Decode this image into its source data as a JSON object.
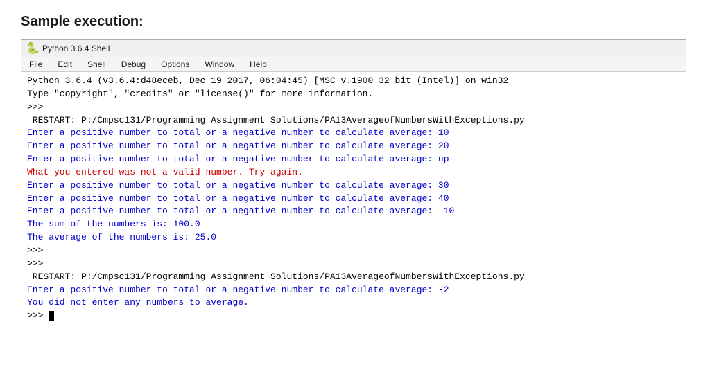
{
  "page": {
    "title": "Sample execution:"
  },
  "titlebar": {
    "icon": "🐍",
    "text": "Python 3.6.4 Shell"
  },
  "menubar": {
    "items": [
      "File",
      "Edit",
      "Shell",
      "Debug",
      "Options",
      "Window",
      "Help"
    ]
  },
  "shell": {
    "lines": [
      {
        "type": "black",
        "text": "Python 3.6.4 (v3.6.4:d48eceb, Dec 19 2017, 06:04:45) [MSC v.1900 32 bit (Intel)] on win32"
      },
      {
        "type": "black",
        "text": "Type \"copyright\", \"credits\" or \"license()\" for more information."
      },
      {
        "type": "prompt",
        "text": ">>>"
      },
      {
        "type": "black",
        "text": " RESTART: P:/Cmpsc131/Programming Assignment Solutions/PA13AverageofNumbersWithExceptions.py"
      },
      {
        "type": "blue",
        "text": "Enter a positive number to total or a negative number to calculate average: 10"
      },
      {
        "type": "blue",
        "text": "Enter a positive number to total or a negative number to calculate average: 20"
      },
      {
        "type": "blue",
        "text": "Enter a positive number to total or a negative number to calculate average: up"
      },
      {
        "type": "red",
        "text": "What you entered was not a valid number. Try again."
      },
      {
        "type": "blue",
        "text": "Enter a positive number to total or a negative number to calculate average: 30"
      },
      {
        "type": "blue",
        "text": "Enter a positive number to total or a negative number to calculate average: 40"
      },
      {
        "type": "blue",
        "text": "Enter a positive number to total or a negative number to calculate average: -10"
      },
      {
        "type": "blue",
        "text": "The sum of the numbers is: 100.0"
      },
      {
        "type": "blue",
        "text": "The average of the numbers is: 25.0"
      },
      {
        "type": "prompt",
        "text": ">>>"
      },
      {
        "type": "prompt",
        "text": ">>>"
      },
      {
        "type": "black",
        "text": " RESTART: P:/Cmpsc131/Programming Assignment Solutions/PA13AverageofNumbersWithExceptions.py"
      },
      {
        "type": "blue",
        "text": "Enter a positive number to total or a negative number to calculate average: -2"
      },
      {
        "type": "blue",
        "text": "You did not enter any numbers to average."
      },
      {
        "type": "prompt_cursor",
        "text": ">>> "
      }
    ]
  }
}
